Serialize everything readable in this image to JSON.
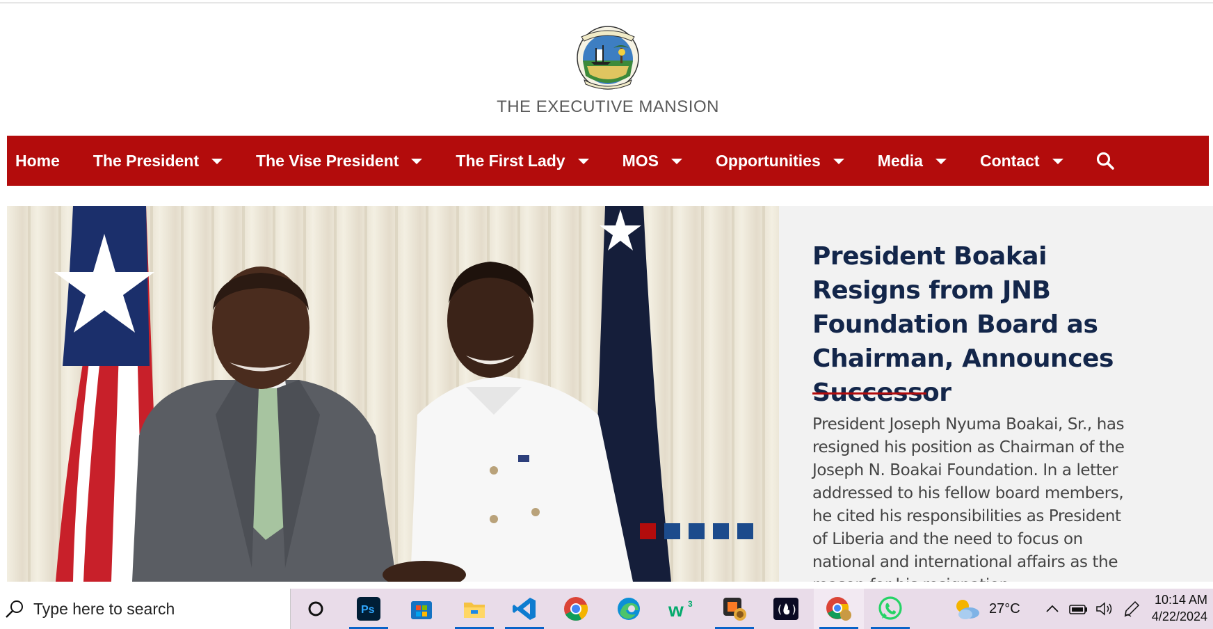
{
  "site": {
    "title": "THE EXECUTIVE MANSION"
  },
  "nav": {
    "items": [
      {
        "label": "Home",
        "dropdown": false
      },
      {
        "label": "The President",
        "dropdown": true
      },
      {
        "label": "The Vise President",
        "dropdown": true
      },
      {
        "label": "The First Lady",
        "dropdown": true
      },
      {
        "label": "MOS",
        "dropdown": true
      },
      {
        "label": "Opportunities",
        "dropdown": true
      },
      {
        "label": "Media",
        "dropdown": true
      },
      {
        "label": "Contact",
        "dropdown": true
      }
    ],
    "search_icon": "search-icon"
  },
  "featured": {
    "headline": "President Boakai Resigns from JNB Foundation Board as Chairman, Announces Successor",
    "excerpt": "President Joseph Nyuma Boakai, Sr., has resigned his position as Chairman of the Joseph N. Boakai Foundation. In a letter addressed to his fellow board members, he cited his responsibilities as President of Liberia and the need to focus on national and international affairs as the reason for his resignation.",
    "slides_total": 5,
    "active_slide": 1
  },
  "taskbar": {
    "search_placeholder": "Type here to search",
    "apps": [
      "cortana-icon",
      "photoshop-icon",
      "microsoft-store-icon",
      "file-explorer-icon",
      "vscode-icon",
      "chrome-icon",
      "edge-icon",
      "w3schools-icon",
      "xampp-icon",
      "freecodecamp-icon",
      "chrome-profile-icon",
      "whatsapp-icon"
    ],
    "weather": "27°C",
    "time": "10:14 AM",
    "date": "4/22/2024"
  },
  "colors": {
    "nav_red": "#b30c0c",
    "headline_navy": "#13264a",
    "dot_blue": "#1c4b8c"
  }
}
